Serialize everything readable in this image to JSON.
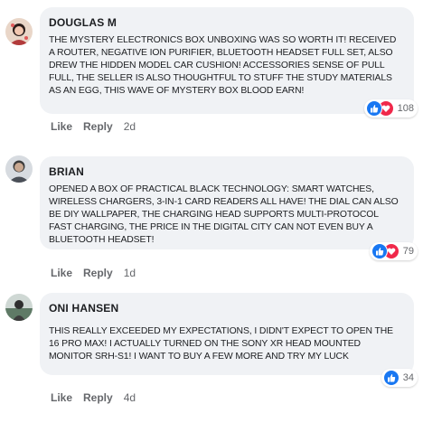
{
  "comments": [
    {
      "author": "DOUGLAS M",
      "text": "THE MYSTERY ELECTRONICS BOX UNBOXING WAS SO WORTH IT! RECEIVED A ROUTER, NEGATIVE ION PURIFIER, BLUETOOTH HEADSET FULL SET, ALSO DREW THE HIDDEN MODEL CAR CUSHION! ACCESSORIES SENSE OF PULL FULL, THE SELLER IS ALSO THOUGHTFUL TO STUFF THE STUDY MATERIALS AS AN EGG, THIS WAVE OF MYSTERY BOX BLOOD EARN!",
      "reaction_count": "108",
      "reactions": [
        "like-icon",
        "love-icon"
      ],
      "like_label": "Like",
      "reply_label": "Reply",
      "time": "2d"
    },
    {
      "author": "BRIAN",
      "text": "OPENED A BOX OF PRACTICAL BLACK TECHNOLOGY: SMART WATCHES, WIRELESS CHARGERS, 3-IN-1 CARD READERS ALL HAVE! THE DIAL CAN ALSO BE DIY WALLPAPER, THE CHARGING HEAD SUPPORTS MULTI-PROTOCOL FAST CHARGING, THE PRICE IN THE DIGITAL CITY CAN NOT EVEN BUY A BLUETOOTH HEADSET!",
      "reaction_count": "79",
      "reactions": [
        "like-icon",
        "love-icon"
      ],
      "like_label": "Like",
      "reply_label": "Reply",
      "time": "1d"
    },
    {
      "author": "ONI HANSEN",
      "text": "THIS REALLY EXCEEDED MY EXPECTATIONS, I DIDN'T EXPECT TO OPEN THE 16 PRO MAX! I ACTUALLY TURNED ON THE SONY XR HEAD MOUNTED MONITOR SRH-S1! I WANT TO BUY A FEW MORE AND TRY MY LUCK",
      "reaction_count": "34",
      "reactions": [
        "like-icon"
      ],
      "like_label": "Like",
      "reply_label": "Reply",
      "time": "4d"
    }
  ],
  "colors": {
    "bubble": "#f0f2f5",
    "like": "#1877f2",
    "love": "#f0284a",
    "secondary_text": "#65676b"
  }
}
